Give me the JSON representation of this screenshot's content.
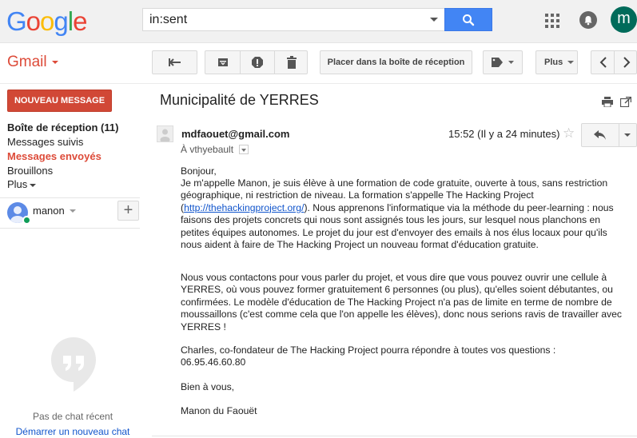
{
  "header": {
    "logo_letters": [
      {
        "char": "G",
        "color": "#4285f4"
      },
      {
        "char": "o",
        "color": "#ea4335"
      },
      {
        "char": "o",
        "color": "#fbbc05"
      },
      {
        "char": "g",
        "color": "#4285f4"
      },
      {
        "char": "l",
        "color": "#34a853"
      },
      {
        "char": "e",
        "color": "#ea4335"
      }
    ],
    "search_value": "in:sent",
    "avatar_letter": "m"
  },
  "toolbar": {
    "app_label": "Gmail",
    "move_inbox_label": "Placer dans la boîte de réception",
    "more_label": "Plus"
  },
  "sidebar": {
    "compose_label": "NOUVEAU MESSAGE",
    "items": [
      {
        "label": "Boîte de réception (11)"
      },
      {
        "label": "Messages suivis"
      },
      {
        "label": "Messages envoyés"
      },
      {
        "label": "Brouillons"
      },
      {
        "label": "Plus"
      }
    ],
    "hangouts_user": "manon",
    "chat_empty": "Pas de chat récent",
    "chat_start": "Démarrer un nouveau chat"
  },
  "message": {
    "subject": "Municipalité de YERRES",
    "sender": "mdfaouet@gmail.com",
    "time": "15:52 (Il y a 24 minutes)",
    "to": "À vthyebault",
    "greeting": "Bonjour,",
    "para1_a": "Je m'appelle Manon, je suis élève à une formation de code gratuite, ouverte à tous, sans restriction géographique, ni restriction de niveau. La formation s'appelle The Hacking Project (",
    "para1_link": "http://thehackingproject.org/",
    "para1_b": "). Nous apprenons l'informatique via la méthode du peer-learning : nous faisons des projets concrets qui nous sont assignés tous les jours, sur lesquel nous planchons en petites équipes autonomes. Le projet du jour est d'envoyer des emails à nos élus locaux pour qu'ils nous aident à faire de The Hacking Project un nouveau format d'éducation gratuite.",
    "para2": "Nous vous contactons pour vous parler du projet, et vous dire que vous pouvez ouvrir une cellule à YERRES, où vous pouvez former gratuitement 6 personnes (ou plus), qu'elles soient débutantes, ou confirmées. Le modèle d'éducation de The Hacking Project n'a pas de limite en terme de nombre de moussaillons (c'est comme cela que l'on appelle les élèves), donc nous serions ravis de travailler avec YERRES !",
    "para3_a": "Charles, co-fondateur de The Hacking Project pourra répondre à toutes vos questions :",
    "para3_b": "06.95.46.60.80",
    "closing": "Bien à vous,",
    "signature": "Manon du Faouët"
  }
}
